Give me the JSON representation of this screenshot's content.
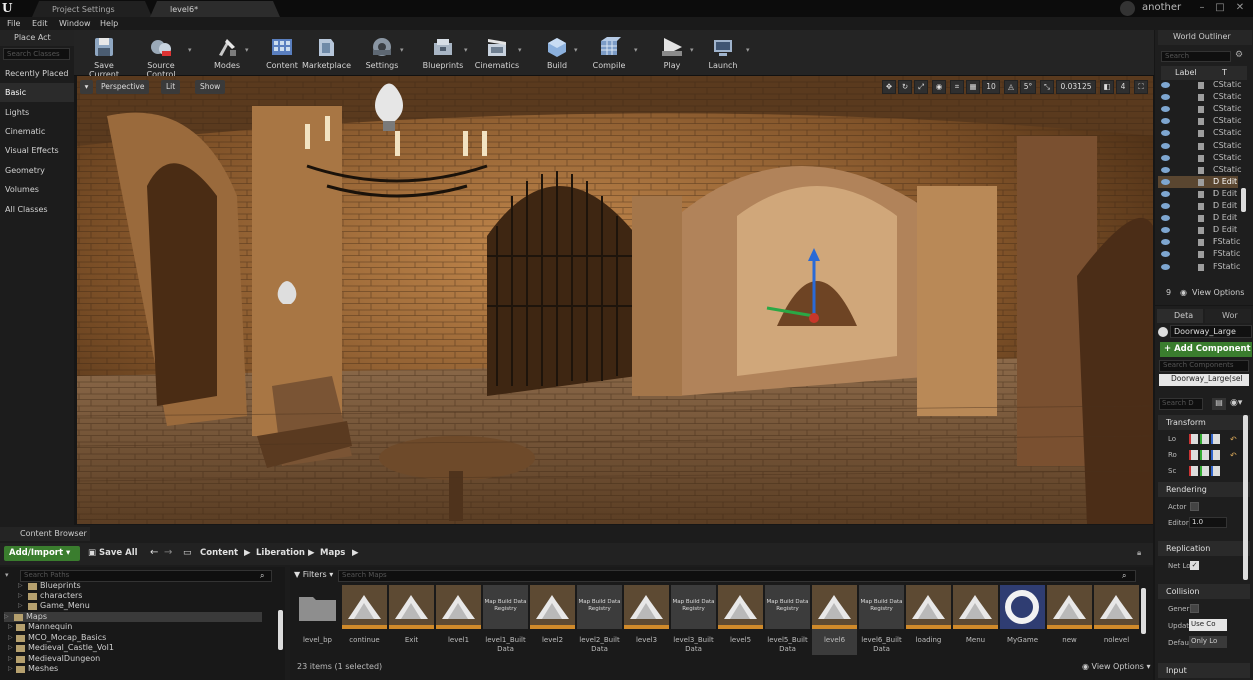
{
  "titlebar": {
    "tabs": [
      "Project Settings",
      "level6*"
    ],
    "user": "another"
  },
  "menu": [
    "File",
    "Edit",
    "Window",
    "Help"
  ],
  "place_actors": {
    "title": "Place Act",
    "search_placeholder": "Search Classes",
    "categories": [
      "Recently Placed",
      "Basic",
      "Lights",
      "Cinematic",
      "Visual Effects",
      "Geometry",
      "Volumes",
      "All Classes"
    ],
    "selected": "Basic"
  },
  "toolbar": [
    {
      "label": "Save Current",
      "icon": "save-icon"
    },
    {
      "label": "Source Control",
      "icon": "source-control-icon"
    },
    {
      "label": "Modes",
      "icon": "modes-icon"
    },
    {
      "label": "Content",
      "icon": "content-icon"
    },
    {
      "label": "Marketplace",
      "icon": "marketplace-icon"
    },
    {
      "label": "Settings",
      "icon": "settings-icon"
    },
    {
      "label": "Blueprints",
      "icon": "blueprints-icon"
    },
    {
      "label": "Cinematics",
      "icon": "cinematics-icon"
    },
    {
      "label": "Build",
      "icon": "build-icon"
    },
    {
      "label": "Compile",
      "icon": "compile-icon"
    },
    {
      "label": "Play",
      "icon": "play-icon"
    },
    {
      "label": "Launch",
      "icon": "launch-icon"
    }
  ],
  "viewport": {
    "perspective": "Perspective",
    "lit": "Lit",
    "show": "Show",
    "snap_grid": "10",
    "snap_rotation": "5°",
    "snap_scale": "0.03125",
    "camera_speed": "4"
  },
  "world_outliner": {
    "title": "World Outliner",
    "search_placeholder": "Search",
    "col_label": "Label",
    "col_type": "T",
    "rows": [
      "CStatic",
      "CStatic",
      "CStatic",
      "CStatic",
      "CStatic",
      "CStatic",
      "CStatic",
      "CStatic",
      "D Edit I",
      "D Edit I",
      "D Edit I",
      "D Edit I",
      "D Edit I",
      "FStatic",
      "FStatic",
      "FStatic"
    ],
    "selected_index": 8,
    "count": "9",
    "view_options": "View Options"
  },
  "details": {
    "tab1": "Deta",
    "tab2": "Wor",
    "actor_name": "Doorway_Large",
    "add_component": "+ Add Component",
    "search_components": "Search Components",
    "component_root": "Doorway_Large(sel",
    "search_details": "Search D",
    "sections": {
      "transform": "Transform",
      "rendering": "Rendering",
      "replication": "Replication",
      "collision": "Collision",
      "input": "Input"
    },
    "props": {
      "location": "Lo",
      "rotation": "Ro",
      "scale": "Sc",
      "actor_hidden": "Actor",
      "editor_billboard": "Editor",
      "billboard_value": "1.0",
      "net_load": "Net Lo",
      "generate": "Gener",
      "update": "Updat",
      "update_value": "Use Co",
      "default": "Defau",
      "default_value": "Only Lo"
    }
  },
  "content_browser": {
    "title": "Content Browser",
    "add_import": "Add/Import",
    "save_all": "Save All",
    "breadcrumb": [
      "Content",
      "Liberation",
      "Maps"
    ],
    "search_paths": "Search Paths",
    "tree": [
      "Blueprints",
      "characters",
      "Game_Menu",
      "Maps",
      "Mannequin",
      "MCO_Mocap_Basics",
      "Medieval_Castle_Vol1",
      "MedievalDungeon",
      "Meshes"
    ],
    "tree_selected": "Maps",
    "filters": "Filters",
    "search_maps": "Search Maps",
    "assets": [
      {
        "name": "level_bp",
        "kind": "folder"
      },
      {
        "name": "continue",
        "kind": "map"
      },
      {
        "name": "Exit",
        "kind": "map"
      },
      {
        "name": "level1",
        "kind": "map"
      },
      {
        "name": "level1_Built Data",
        "kind": "registry"
      },
      {
        "name": "level2",
        "kind": "map"
      },
      {
        "name": "level2_Built Data",
        "kind": "registry"
      },
      {
        "name": "level3",
        "kind": "map"
      },
      {
        "name": "level3_Built Data",
        "kind": "registry"
      },
      {
        "name": "level5",
        "kind": "map"
      },
      {
        "name": "level5_Built Data",
        "kind": "registry"
      },
      {
        "name": "level6",
        "kind": "map"
      },
      {
        "name": "level6_Built Data",
        "kind": "registry"
      },
      {
        "name": "loading",
        "kind": "map"
      },
      {
        "name": "Menu",
        "kind": "map"
      },
      {
        "name": "MyGame",
        "kind": "ring"
      },
      {
        "name": "new",
        "kind": "map"
      },
      {
        "name": "nolevel",
        "kind": "map"
      }
    ],
    "registry_label": "Map Build Data Registry",
    "selected_asset": "level6",
    "status": "23 items (1 selected)",
    "view_options": "View Options"
  },
  "colors": {
    "accent_green": "#3a7d2e",
    "selection": "#5a4630",
    "panel_bg": "#1e1e1e"
  }
}
